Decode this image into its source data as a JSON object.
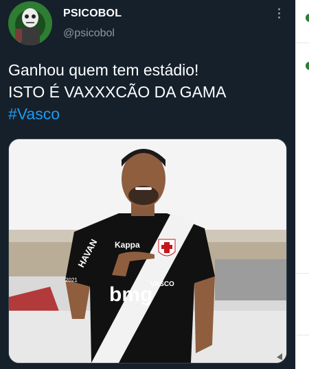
{
  "tweet": {
    "display_name": "PSICOBOL",
    "handle": "@psicobol",
    "text_line1": "Ganhou quem tem estádio!",
    "text_line2": "ISTO É VAXXXCÃO DA GAMA",
    "hashtag": "#Vasco",
    "hashtag_color": "#1d9bf0",
    "background_color": "#15202b",
    "more_icon": "more-vertical-icon"
  },
  "media": {
    "jersey_sponsor": "bmg",
    "jersey_sponsor_small": "VASCO",
    "jersey_brand": "Kappa",
    "jersey_side_text": "HAVAN",
    "jersey_year": "2021"
  }
}
